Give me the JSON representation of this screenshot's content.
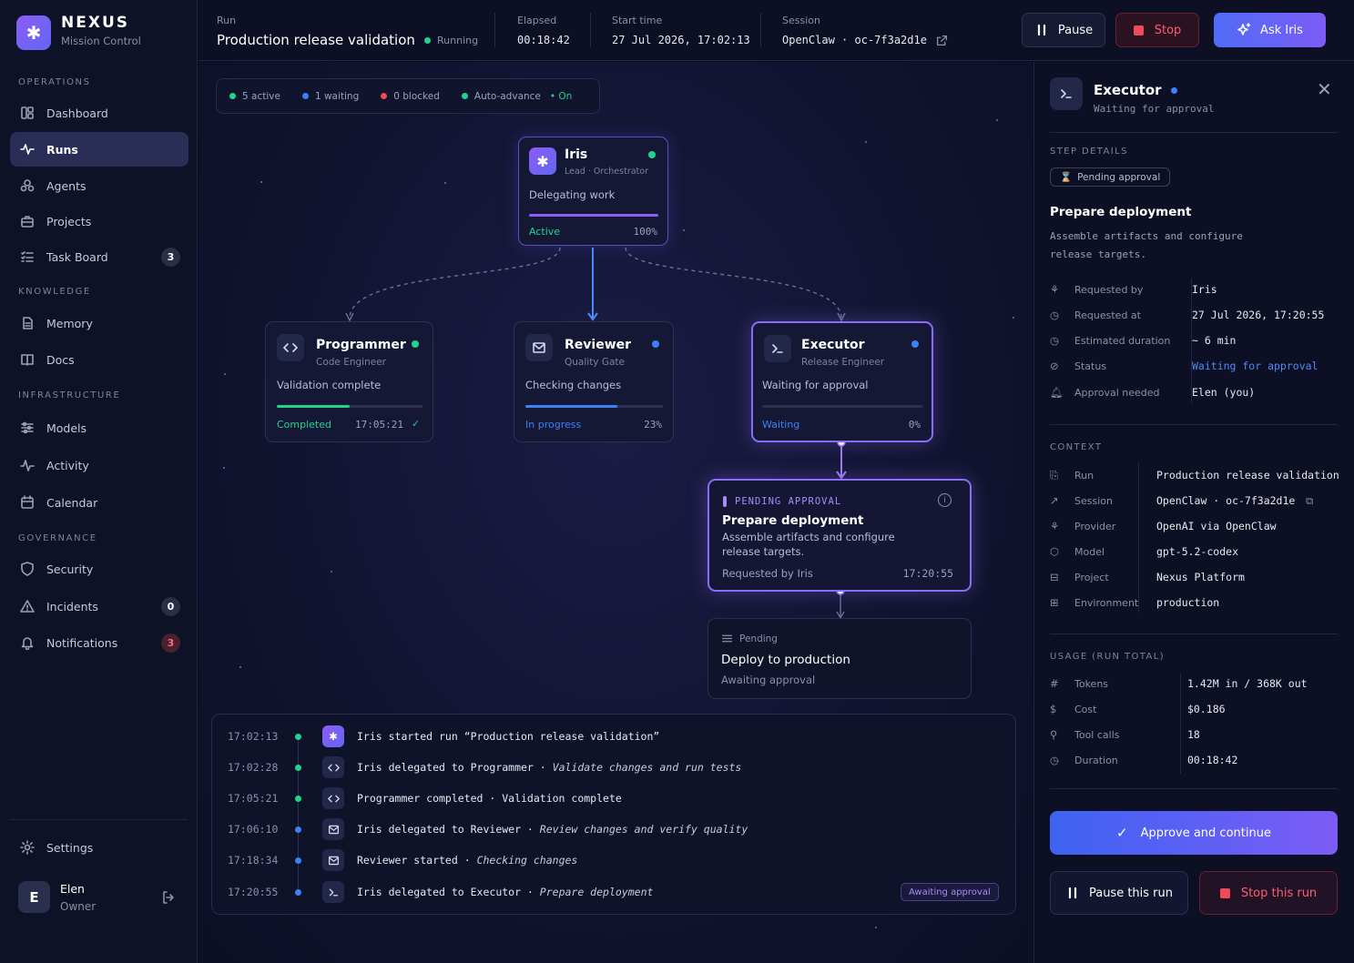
{
  "brand": {
    "name": "NEXUS",
    "subtitle": "Mission Control"
  },
  "sidebar": {
    "sections": {
      "operations": "OPERATIONS",
      "knowledge": "KNOWLEDGE",
      "infrastructure": "INFRASTRUCTURE",
      "governance": "GOVERNANCE"
    },
    "items": {
      "dashboard": "Dashboard",
      "runs": "Runs",
      "agents": "Agents",
      "projects": "Projects",
      "taskboard": "Task Board",
      "taskboard_count": "3",
      "memory": "Memory",
      "docs": "Docs",
      "models": "Models",
      "activity": "Activity",
      "calendar": "Calendar",
      "security": "Security",
      "incidents": "Incidents",
      "incidents_count": "0",
      "notifications": "Notifications",
      "notifications_count": "3",
      "settings": "Settings"
    },
    "user": {
      "initial": "E",
      "name": "Elen",
      "role": "Owner"
    }
  },
  "header": {
    "run_label": "Run",
    "run_title": "Production release validation",
    "run_status": "Running",
    "elapsed_label": "Elapsed",
    "elapsed": "00:18:42",
    "start_label": "Start time",
    "start": "27 Jul 2026, 17:02:13",
    "session_label": "Session",
    "session": "OpenClaw · oc-7f3a2d1e",
    "pause": "Pause",
    "stop": "Stop",
    "ask": "Ask Iris"
  },
  "status_bar": {
    "active": "5 active",
    "waiting": "1 waiting",
    "blocked": "0 blocked",
    "auto": "Auto-advance",
    "auto_state": "On"
  },
  "nodes": {
    "iris": {
      "name": "Iris",
      "role": "Lead · Orchestrator",
      "desc": "Delegating work",
      "state": "Active",
      "progress_label": "100%",
      "progress": 1.0
    },
    "programmer": {
      "name": "Programmer",
      "role": "Code Engineer",
      "desc": "Validation complete",
      "state": "Completed",
      "time": "17:05:21",
      "progress": 0.5
    },
    "reviewer": {
      "name": "Reviewer",
      "role": "Quality Gate",
      "desc": "Checking changes",
      "state": "In progress",
      "progress_label": "23%",
      "progress": 0.67
    },
    "executor": {
      "name": "Executor",
      "role": "Release Engineer",
      "desc": "Waiting for approval",
      "state": "Waiting",
      "progress_label": "0%",
      "progress": 0.0
    },
    "approval": {
      "tag": "PENDING APPROVAL",
      "title": "Prepare deployment",
      "desc": "Assemble artifacts and configure release targets.",
      "requested": "Requested by Iris",
      "time": "17:20:55"
    },
    "deploy": {
      "tag": "Pending",
      "title": "Deploy to production",
      "desc": "Awaiting approval"
    }
  },
  "log": [
    {
      "time": "17:02:13",
      "text": "Iris started run “Production release validation”",
      "detail": ""
    },
    {
      "time": "17:02:28",
      "text": "Iris delegated to Programmer · ",
      "detail": "Validate changes and run tests"
    },
    {
      "time": "17:05:21",
      "text": "Programmer completed · Validation complete",
      "detail": ""
    },
    {
      "time": "17:06:10",
      "text": "Iris delegated to Reviewer · ",
      "detail": "Review changes and verify quality"
    },
    {
      "time": "17:18:34",
      "text": "Reviewer started · ",
      "detail": "Checking changes"
    },
    {
      "time": "17:20:55",
      "text": "Iris delegated to Executor · ",
      "detail": "Prepare deployment"
    }
  ],
  "log_badge": "Awaiting approval",
  "panel": {
    "title": "Executor",
    "subtitle": "Waiting for approval",
    "step_details": "STEP DETAILS",
    "pending_pill": "Pending approval",
    "step_title": "Prepare deployment",
    "step_desc": "Assemble artifacts and configure release targets.",
    "details": [
      {
        "k": "Requested by",
        "v": "Iris"
      },
      {
        "k": "Requested at",
        "v": "27 Jul 2026, 17:20:55"
      },
      {
        "k": "Estimated duration",
        "v": "~ 6 min"
      },
      {
        "k": "Status",
        "v": "Waiting for approval"
      },
      {
        "k": "Approval needed",
        "v": "Elen (you)"
      }
    ],
    "context_label": "CONTEXT",
    "context": [
      {
        "k": "Run",
        "v": "Production release validation"
      },
      {
        "k": "Session",
        "v": "OpenClaw · oc-7f3a2d1e"
      },
      {
        "k": "Provider",
        "v": "OpenAI via OpenClaw"
      },
      {
        "k": "Model",
        "v": "gpt-5.2-codex"
      },
      {
        "k": "Project",
        "v": "Nexus Platform"
      },
      {
        "k": "Environment",
        "v": "production"
      }
    ],
    "usage_label": "USAGE (RUN TOTAL)",
    "usage": [
      {
        "k": "Tokens",
        "v": "1.42M in / 368K out"
      },
      {
        "k": "Cost",
        "v": "$0.186"
      },
      {
        "k": "Tool calls",
        "v": "18"
      },
      {
        "k": "Duration",
        "v": "00:18:42"
      }
    ],
    "approve": "Approve and continue",
    "pause_run": "Pause this run",
    "stop_run": "Stop this run"
  },
  "colors": {
    "accent": "#6d5cf6",
    "green": "#22d38c",
    "blue": "#3b82f6",
    "red": "#ef4a5a",
    "purple": "#a78bfa"
  }
}
